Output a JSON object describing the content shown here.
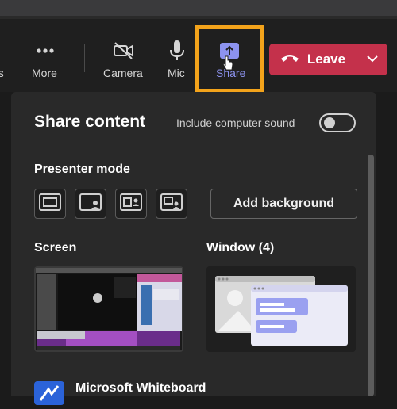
{
  "toolbar": {
    "partial_label": "ns",
    "more_label": "More",
    "camera_label": "Camera",
    "mic_label": "Mic",
    "share_label": "Share",
    "leave_label": "Leave"
  },
  "colors": {
    "accent": "#7b83eb",
    "leave": "#c4314b",
    "highlight": "#f3a31b"
  },
  "panel": {
    "title": "Share content",
    "sound_label": "Include computer sound",
    "sound_enabled": false,
    "presenter_mode_label": "Presenter mode",
    "presenter_modes": [
      "content-only-icon",
      "standout-icon",
      "side-by-side-icon",
      "reporter-icon"
    ],
    "add_background_label": "Add background",
    "screen_label": "Screen",
    "window_label": "Window (4)",
    "whiteboard_label": "Microsoft Whiteboard"
  }
}
